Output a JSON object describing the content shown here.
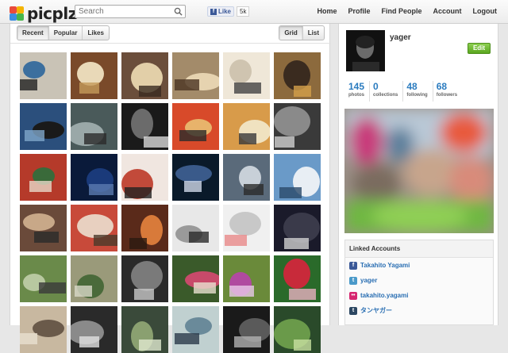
{
  "header": {
    "logo_text": "picplz",
    "search_placeholder": "Search",
    "fb_like_label": "Like",
    "fb_like_count": "5k",
    "nav": [
      "Home",
      "Profile",
      "Find People",
      "Account",
      "Logout"
    ]
  },
  "feed": {
    "sort_tabs": [
      "Recent",
      "Popular",
      "Likes"
    ],
    "active_sort": "Recent",
    "view_tabs": [
      "Grid",
      "List"
    ],
    "active_view": "Grid",
    "photo_count": 36
  },
  "profile": {
    "username": "yager",
    "edit_label": "Edit",
    "stats": [
      {
        "value": "145",
        "label": "photos"
      },
      {
        "value": "0",
        "label": "collections"
      },
      {
        "value": "48",
        "label": "following"
      },
      {
        "value": "68",
        "label": "followers"
      }
    ]
  },
  "linked": {
    "title": "Linked Accounts",
    "accounts": [
      {
        "service": "facebook-icon",
        "name": "Takahito Yagami",
        "color": "#3b5998"
      },
      {
        "service": "twitter-icon",
        "name": "yager",
        "color": "#4a99c9"
      },
      {
        "service": "flickr-icon",
        "name": "takahito.yagami",
        "color": "#d6266f"
      },
      {
        "service": "tumblr-icon",
        "name": "タンヤガー",
        "color": "#2c4762"
      }
    ]
  },
  "colors": {
    "accent_blue": "#2a7bbf",
    "edit_green": "#6cb52e"
  }
}
